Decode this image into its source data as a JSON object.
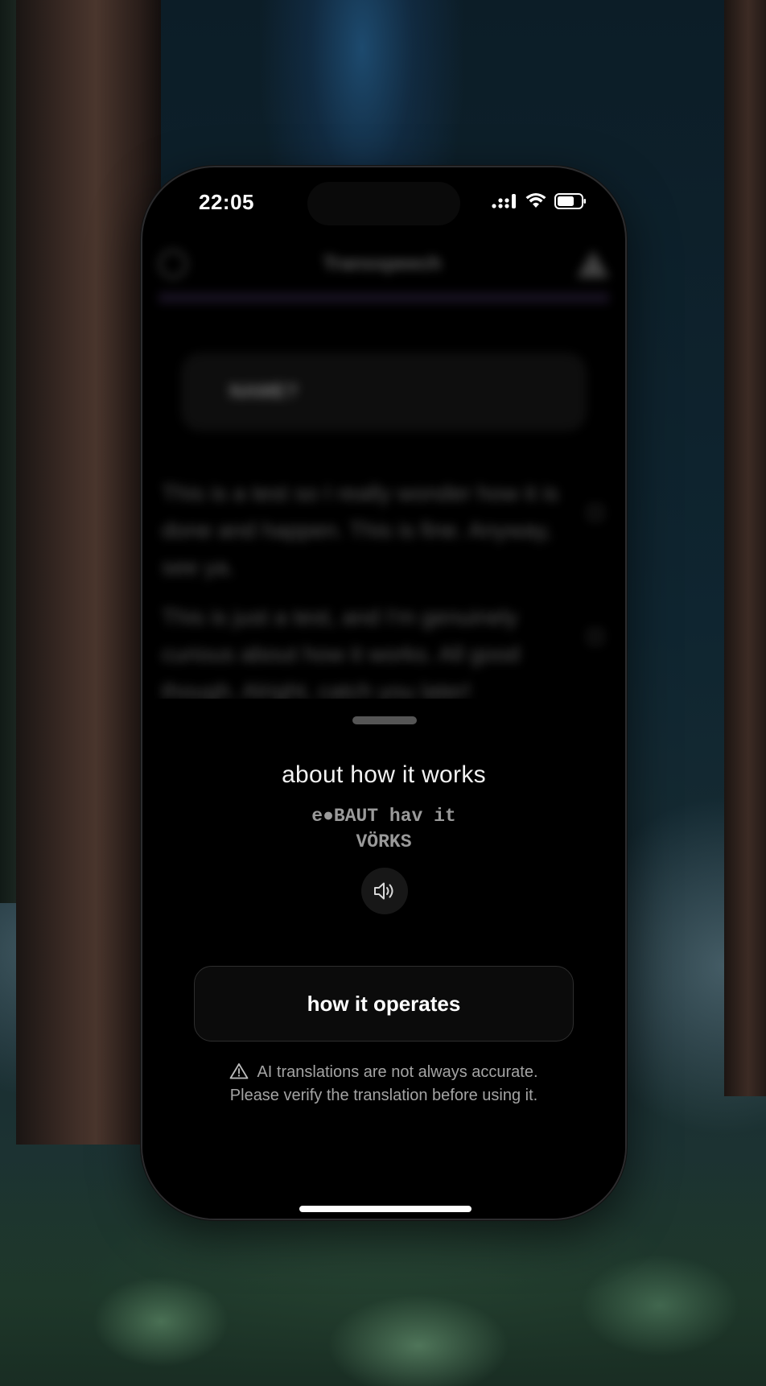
{
  "status_bar": {
    "time": "22:05",
    "icons": [
      "cellular-signal-icon",
      "wifi-icon",
      "battery-icon"
    ]
  },
  "background_app": {
    "title": "Transspeech",
    "input_label": "NAME?",
    "paragraphs": [
      "This is a test so I really wonder how it is done and happen. This is fine. Anyway, see ya.",
      "This is just a test, and I'm genuinely curious about how it works. All good though. Alright, catch you later!"
    ]
  },
  "sheet": {
    "phrase": "about how it works",
    "phonetic_line1": "e●BAUT hav it",
    "phonetic_line2": "VÖRKS",
    "translation": "how it operates",
    "disclaimer_line1": "AI translations are not always accurate.",
    "disclaimer_line2": "Please verify the translation before using it."
  },
  "colors": {
    "sheet_bg": "#000000",
    "card_border": "#2e2e2e",
    "text_primary": "#f2f2f2",
    "text_secondary": "#9a9a9a"
  }
}
